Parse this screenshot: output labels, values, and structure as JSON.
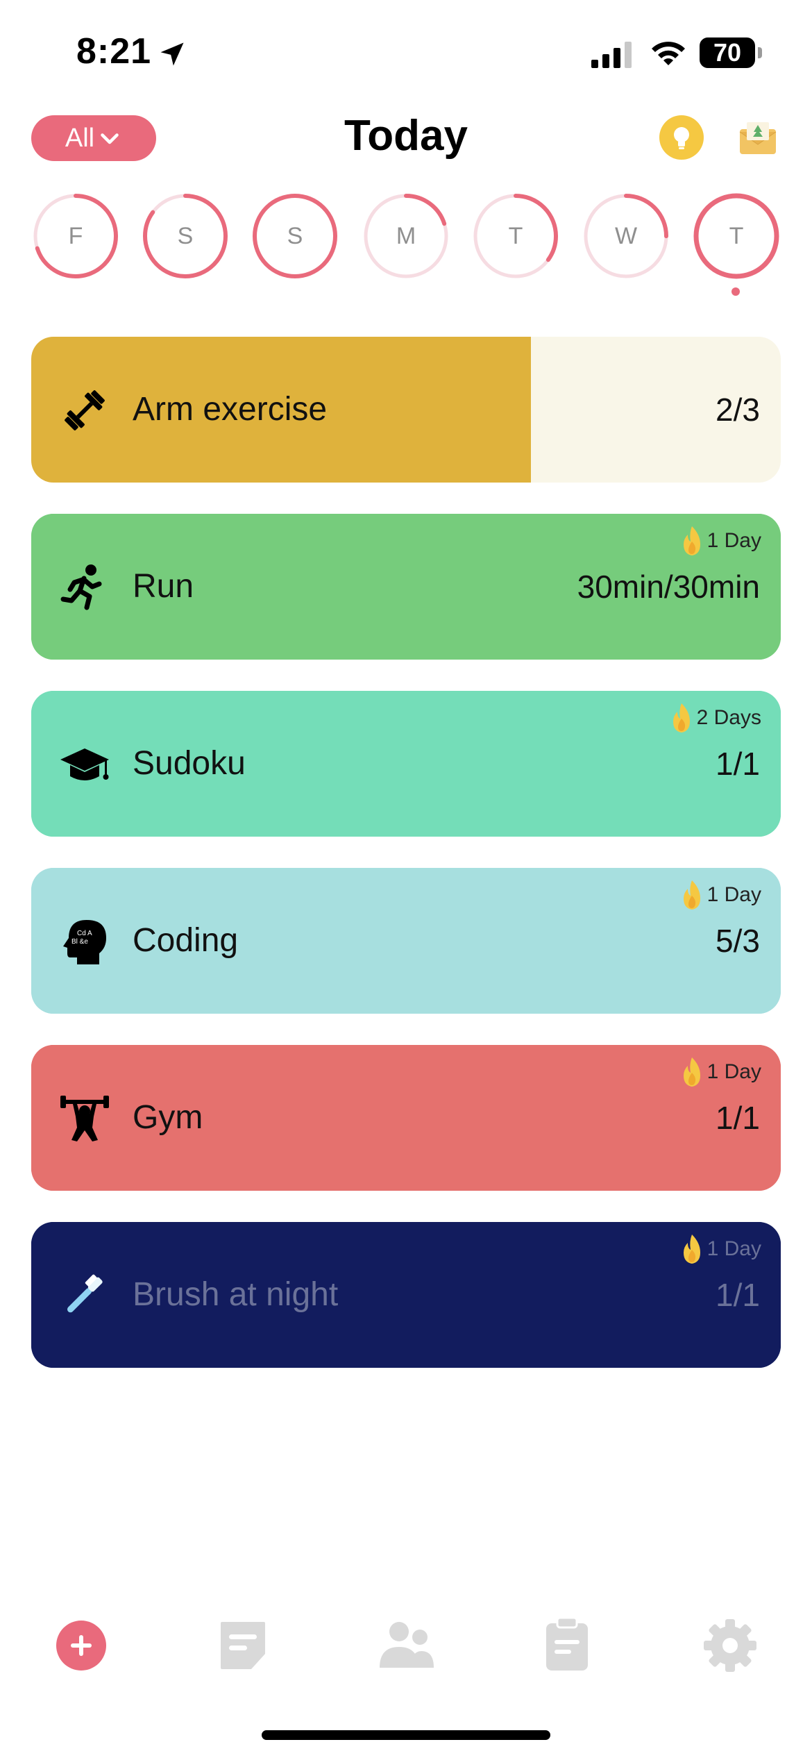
{
  "status_bar": {
    "time": "8:21",
    "battery": "70"
  },
  "header": {
    "filter_label": "All",
    "title": "Today"
  },
  "week": [
    {
      "letter": "F",
      "progress": 0.7,
      "is_today": false
    },
    {
      "letter": "S",
      "progress": 0.85,
      "is_today": false
    },
    {
      "letter": "S",
      "progress": 1.0,
      "is_today": false
    },
    {
      "letter": "M",
      "progress": 0.2,
      "is_today": false
    },
    {
      "letter": "T",
      "progress": 0.35,
      "is_today": false
    },
    {
      "letter": "W",
      "progress": 0.25,
      "is_today": false
    },
    {
      "letter": "T",
      "progress": 1.0,
      "is_today": true
    }
  ],
  "habits": [
    {
      "name": "Arm exercise",
      "icon": "dumbbell-icon",
      "progress": "2/3",
      "streak": "",
      "completion": 0.667,
      "color": "#DFB23C",
      "bg": "#F9F6E8",
      "text_color": "#111111"
    },
    {
      "name": "Run",
      "icon": "runner-icon",
      "progress": "30min/30min",
      "streak": "1 Day",
      "completion": 1.0,
      "color": "#76CC7C",
      "bg": "#76CC7C",
      "text_color": "#111111"
    },
    {
      "name": "Sudoku",
      "icon": "graduation-cap-icon",
      "progress": "1/1",
      "streak": "2 Days",
      "completion": 1.0,
      "color": "#74DDB8",
      "bg": "#74DDB8",
      "text_color": "#111111"
    },
    {
      "name": "Coding",
      "icon": "brain-head-icon",
      "progress": "5/3",
      "streak": "1 Day",
      "completion": 1.0,
      "color": "#A7DFDF",
      "bg": "#A7DFDF",
      "text_color": "#111111"
    },
    {
      "name": "Gym",
      "icon": "weightlifter-icon",
      "progress": "1/1",
      "streak": "1 Day",
      "completion": 1.0,
      "color": "#E5716E",
      "bg": "#E5716E",
      "text_color": "#111111"
    },
    {
      "name": "Brush at night",
      "icon": "toothbrush-icon",
      "progress": "1/1",
      "streak": "1 Day",
      "completion": 1.0,
      "color": "#121C5E",
      "bg": "#121C5E",
      "text_color": "#6B7299"
    }
  ],
  "colors": {
    "accent": "#E96A7C",
    "ring_track": "#F6DCE2",
    "flame": "#F5C842",
    "tab_inactive": "#D9D9D9"
  },
  "tabs": [
    {
      "icon": "add-icon"
    },
    {
      "icon": "notes-icon"
    },
    {
      "icon": "friends-icon"
    },
    {
      "icon": "clipboard-icon"
    },
    {
      "icon": "settings-gear-icon"
    }
  ]
}
